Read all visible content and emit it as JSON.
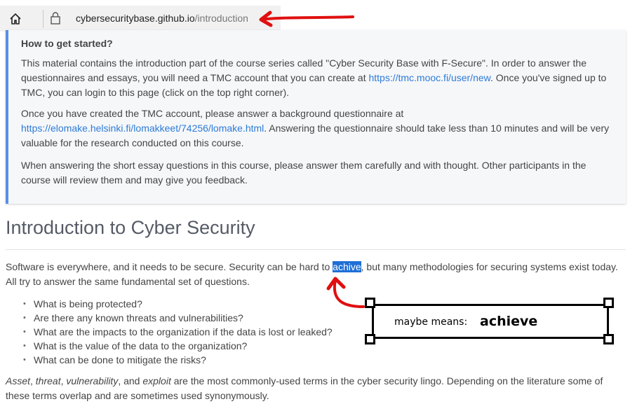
{
  "browser": {
    "url_domain": "cybersecuritybase.github.io",
    "url_path": "/introduction",
    "icons": [
      "home-icon",
      "lock-icon"
    ]
  },
  "card": {
    "title": "How to get started?",
    "p1_a": "This material contains the introduction part of the course series called \"Cyber Security Base with F-Secure\". In order to answer the questionnaires and essays, you will need a TMC account that you can create at ",
    "p1_link": "https://tmc.mooc.fi/user/new",
    "p1_b": ". Once you've signed up to TMC, you can login to this page (click on the top right corner).",
    "p2_a": "Once you have created the TMC account, please answer a background questionnaire at ",
    "p2_link": "https://elomake.helsinki.fi/lomakkeet/74256/lomake.html",
    "p2_b": ". Answering the questionnaire should take less than 10 minutes and will be very valuable for the research conducted on this course.",
    "p3": "When answering the short essay questions in this course, please answer them carefully and with thought. Other participants in the course will review them and may give you feedback."
  },
  "main": {
    "heading": "Introduction to Cyber Security",
    "intro_a": "Software is everywhere, and it needs to be secure. Security can be hard to ",
    "intro_highlight": "achive",
    "intro_b": ", but many methodologies for securing systems exist today. All try to answer the same fundamental set of questions.",
    "questions": [
      "What is being protected?",
      "Are there any known threats and vulnerabilities?",
      "What are the impacts to the organization if the data is lost or leaked?",
      "What is the value of the data to the organization?",
      "What can be done to mitigate the risks?"
    ],
    "terms": {
      "t1": "Asset",
      "t2": "threat",
      "t3": "vulnerability",
      "t4": "exploit",
      "sep1": ", ",
      "sep2": ", ",
      "sep3": ", and ",
      "rest": " are the most commonly-used terms in the cyber security lingo. Depending on the literature some of these terms overlap and are sometimes used synonymously."
    }
  },
  "annotation": {
    "label": "maybe means:",
    "word": "achieve",
    "arrow_color": "#e01010"
  }
}
